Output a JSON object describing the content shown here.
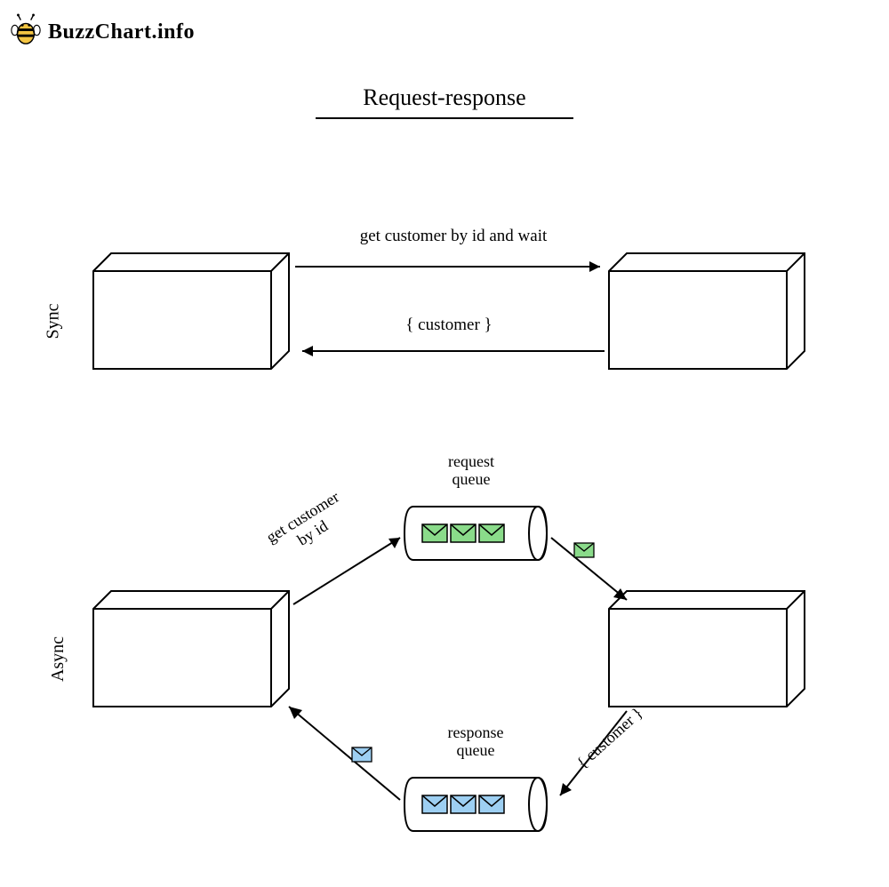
{
  "logo": {
    "text": "BuzzChart.info"
  },
  "title": "Request-response",
  "sections": {
    "sync": {
      "label": "Sync",
      "request_label": "get customer by id and wait",
      "response_label": "{ customer }"
    },
    "async": {
      "label": "Async",
      "request_label": "get customer\nby id",
      "request_queue_label": "request\nqueue",
      "response_queue_label": "response\nqueue",
      "response_label": "{ customer }"
    }
  },
  "colors": {
    "green_envelope": "#8adb8a",
    "blue_envelope": "#9dcff2"
  }
}
